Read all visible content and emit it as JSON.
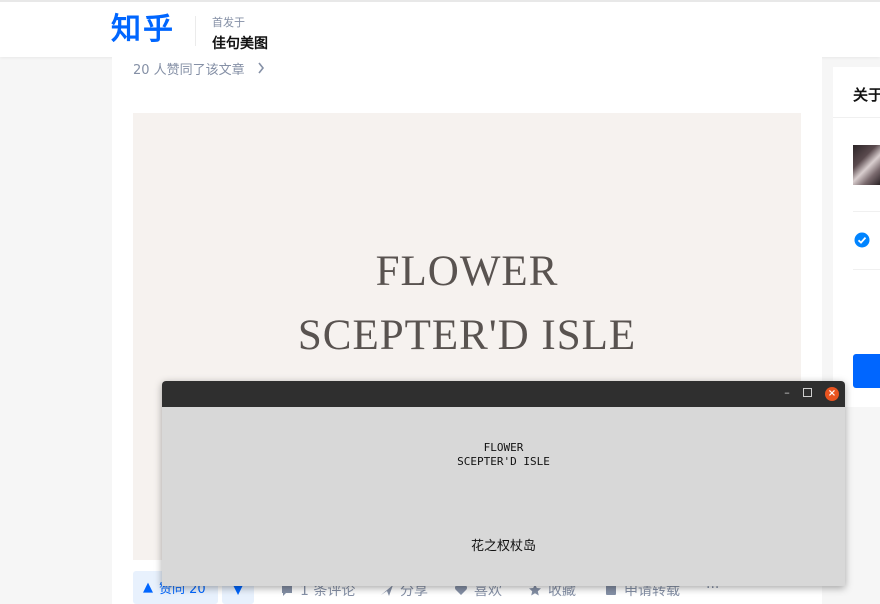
{
  "header": {
    "logo": "知乎",
    "published_in_label": "首发于",
    "publication_name": "佳句美图"
  },
  "article": {
    "likes_text": "20 人赞同了该文章",
    "cover_line1": "FLOWER",
    "cover_line2": "SCEPTER'D ISLE",
    "cover_bg": "#f6f2ef"
  },
  "actions": {
    "upvote_label": "赞同 20",
    "comments_label": "1 条评论",
    "share_label": "分享",
    "like_label": "喜欢",
    "favorite_label": "收藏",
    "repost_label": "申请转载",
    "more_label": "···"
  },
  "sidebar": {
    "title": "关于"
  },
  "window": {
    "line1": "FLOWER",
    "line2": "SCEPTER'D ISLE",
    "chinese": "花之权杖岛",
    "minimize_glyph": "–",
    "close_glyph": "×"
  },
  "colors": {
    "brand": "#0066ff",
    "close_button": "#e95420",
    "titlebar": "#2f2f2f"
  }
}
